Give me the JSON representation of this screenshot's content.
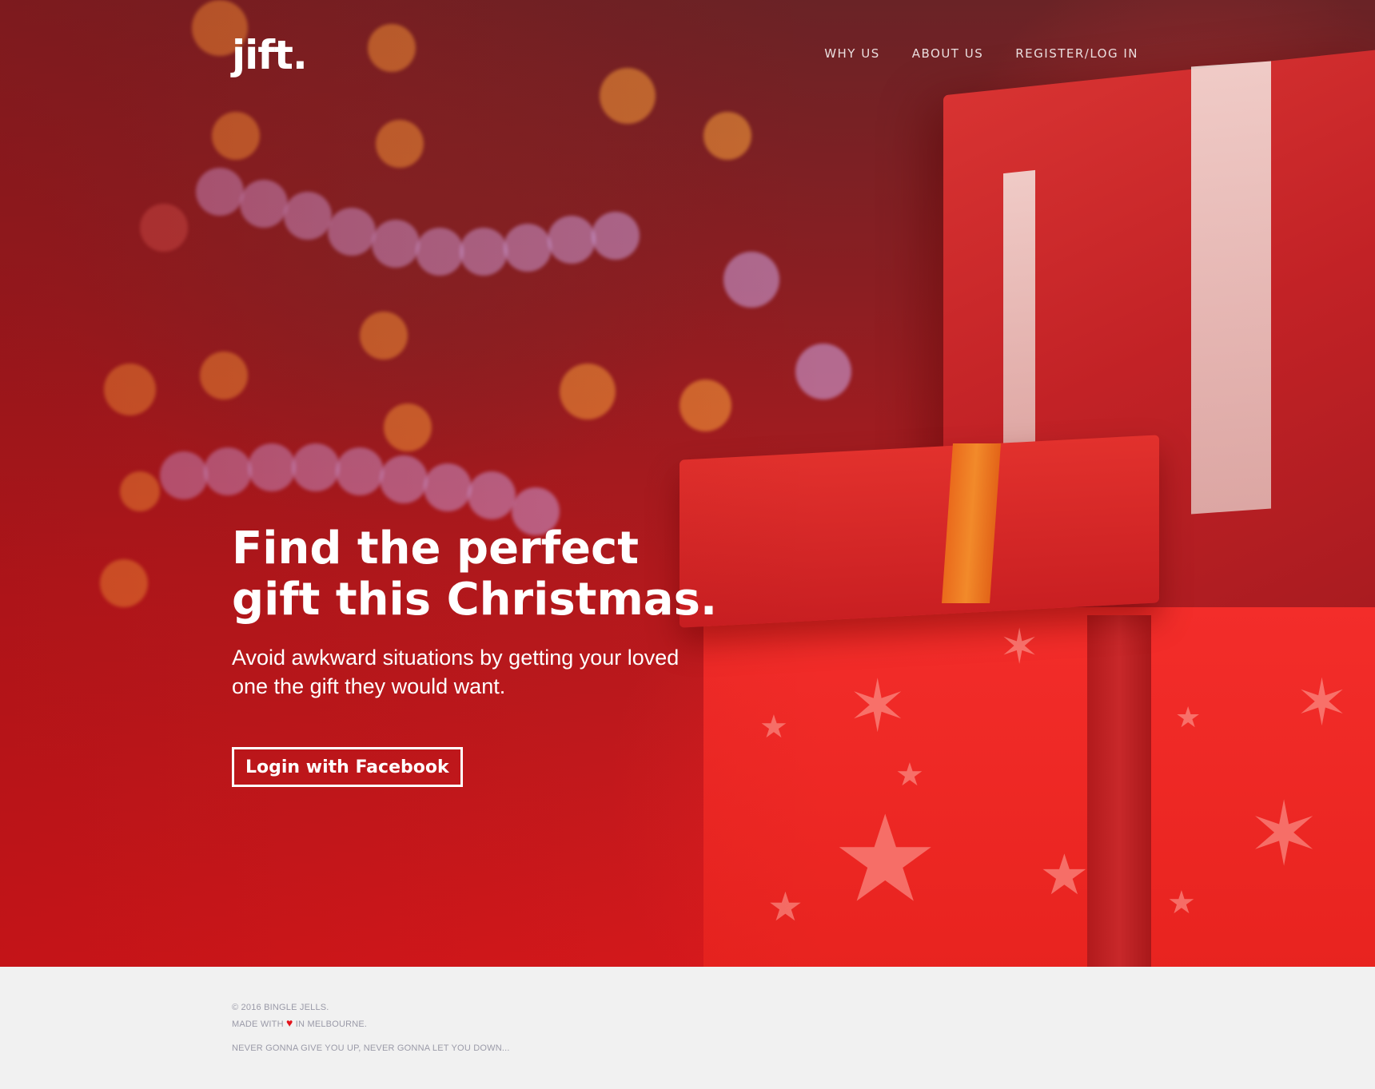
{
  "brand": {
    "logo_text": "jift."
  },
  "nav": {
    "items": [
      {
        "label": "WHY US"
      },
      {
        "label": "ABOUT US"
      },
      {
        "label": "REGISTER/LOG IN"
      }
    ]
  },
  "hero": {
    "headline": "Find the perfect gift this Christmas.",
    "subheadline": "Avoid awkward situations by getting your loved one the gift they would want.",
    "cta_label": "Login with Facebook"
  },
  "footer": {
    "copyright": "© 2016 BINGLE JELLS.",
    "made_with_prefix": "MADE WITH",
    "made_with_suffix": "IN MELBOURNE.",
    "tagline": "NEVER GONNA GIVE YOU UP, NEVER GONNA LET YOU DOWN..."
  },
  "colors": {
    "accent": "#d7191c",
    "heart": "#e3121a",
    "footer_bg": "#f1f1f1",
    "footer_text": "#9a9aa8"
  }
}
